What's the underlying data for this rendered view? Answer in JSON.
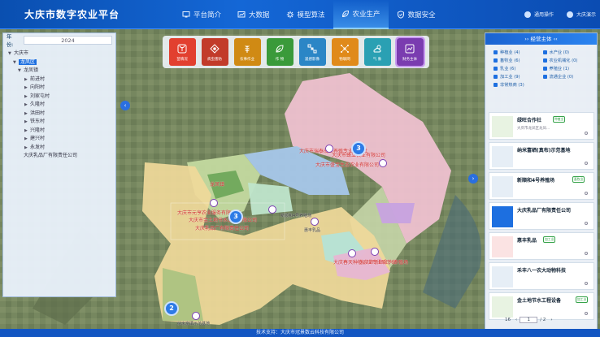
{
  "header": {
    "title": "大庆市数字农业平台",
    "user_msg": "通用操作",
    "user_name": "大庆演示"
  },
  "nav": [
    {
      "label": "平台简介",
      "icon": "monitor-icon"
    },
    {
      "label": "大数据",
      "icon": "chart-icon"
    },
    {
      "label": "模型算法",
      "icon": "gear-icon"
    },
    {
      "label": "农业生产",
      "icon": "leaf-icon",
      "active": true
    },
    {
      "label": "数据安全",
      "icon": "shield-icon"
    }
  ],
  "left": {
    "year_label": "年份:",
    "year_value": "2024",
    "tree": [
      {
        "label": "大庆市",
        "level": 0
      },
      {
        "label": "龙凤区",
        "level": 1,
        "selected": true
      },
      {
        "label": "龙凤镇",
        "level": 2
      },
      {
        "label": "前进村",
        "level": 3
      },
      {
        "label": "向阳村",
        "level": 3
      },
      {
        "label": "刘家屯村",
        "level": 3
      },
      {
        "label": "久隆村",
        "level": 3
      },
      {
        "label": "洪田村",
        "level": 3
      },
      {
        "label": "铁东村",
        "level": 3
      },
      {
        "label": "兴隆村",
        "level": 3
      },
      {
        "label": "建兴村",
        "level": 3
      },
      {
        "label": "永发村",
        "level": 3
      },
      {
        "label": "大庆乳品厂有限责任公司",
        "level": 2
      }
    ]
  },
  "tools": [
    {
      "label": "苗情况",
      "color": "#e2402f"
    },
    {
      "label": "病虫害防",
      "color": "#c23b2a"
    },
    {
      "label": "农事作业",
      "color": "#d08a14"
    },
    {
      "label": "作 物",
      "color": "#3a9a3a"
    },
    {
      "label": "遥感影像",
      "color": "#2b86c6"
    },
    {
      "label": "物联网",
      "color": "#e08a1a"
    },
    {
      "label": "气 象",
      "color": "#2aa0b3"
    },
    {
      "label": "财务主体",
      "color": "#7a3cb0",
      "active": true
    }
  ],
  "right": {
    "title": "经营主体",
    "filters": [
      {
        "label": "种植业 (4)"
      },
      {
        "label": "水产业 (0)"
      },
      {
        "label": "畜牧业 (6)"
      },
      {
        "label": "农业机械化 (0)"
      },
      {
        "label": "乳业 (6)"
      },
      {
        "label": "养殖业 (1)"
      },
      {
        "label": "加工业 (9)"
      },
      {
        "label": "流通企业 (0)"
      },
      {
        "label": "非常热商 (3)"
      }
    ],
    "cards": [
      {
        "name": "绿旺合作社",
        "tag": "种植业",
        "addr": "大庆市龙凤区龙凤..."
      },
      {
        "name": "纳米富硒(真布)示范基地",
        "tag": "",
        "addr": ""
      },
      {
        "name": "新顺和4号养殖场",
        "tag": "畜牧业",
        "addr": ""
      },
      {
        "name": "大庆乳品厂有限责任公司",
        "tag": "",
        "addr": ""
      },
      {
        "name": "惠丰乳品",
        "tag": "加工业",
        "addr": ""
      },
      {
        "name": "禾丰八一农大动物科技",
        "tag": "",
        "addr": ""
      },
      {
        "name": "金土地节水工程设备",
        "tag": "加工业",
        "addr": ""
      }
    ],
    "pager": {
      "total": "16",
      "current": "1",
      "pages": "/ 2"
    }
  },
  "map": {
    "labels": [
      {
        "text": "大庆市瑞泰成兰养殖专业合作社",
        "color": "#d02a2a"
      },
      {
        "text": "大庆市蜂立农业有限公司",
        "color": "#d02a2a"
      },
      {
        "text": "大庆市盛宝生态农业有限公司",
        "color": "#d02a2a"
      },
      {
        "text": "龙凤镇",
        "color": "#d02a2a"
      },
      {
        "text": "大庆市元亨农业服务有限公司",
        "color": "#d02a2a"
      },
      {
        "text": "大庆市金土地节水设备有限公司",
        "color": "#d02a2a"
      },
      {
        "text": "大庆乳品厂有限责任公司",
        "color": "#d02a2a"
      },
      {
        "text": "大庆春天种植农业专业合作社",
        "color": "#d02a2a"
      },
      {
        "text": "大庆市新顺和兴养殖场",
        "color": "#d02a2a"
      },
      {
        "text": "新顺和4号养殖场",
        "color": "#333"
      },
      {
        "text": "惠丰乳品",
        "color": "#333"
      },
      {
        "text": "纳米富硒示范基地",
        "color": "#333"
      }
    ],
    "clusters": [
      "3",
      "3",
      "2"
    ]
  },
  "footer": {
    "text": "技术支持：大庆市冠景数云科技有限公司"
  }
}
